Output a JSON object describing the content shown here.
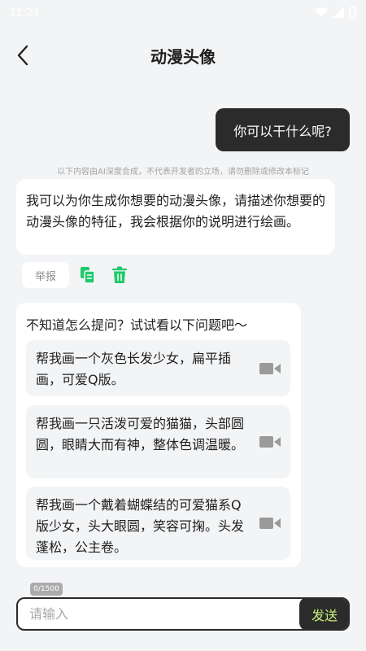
{
  "status_bar": {
    "time": "11:24"
  },
  "header": {
    "title": "动漫头像"
  },
  "chat": {
    "user_message": "你可以干什么呢?",
    "ai_notice": "以下内容由AI深度合成，不代表开发者的立场，请勿删除或修改本标记",
    "ai_reply": "我可以为你生成你想要的动漫头像，请描述你想要的动漫头像的特征，我会根据你的说明进行绘画。",
    "report_label": "举报"
  },
  "suggestions": {
    "title": "不知道怎么提问？试试看以下问题吧～",
    "items": [
      {
        "text": "帮我画一个灰色长发少女，扁平插画，可爱Q版。"
      },
      {
        "text": "帮我画一只活泼可爱的猫猫，头部圆圆，眼睛大而有神，整体色调温暖。"
      },
      {
        "text": "帮我画一个戴着蝴蝶结的可爱猫系Q版少女，头大眼圆，笑容可掬。头发蓬松，公主卷。"
      }
    ]
  },
  "composer": {
    "counter": "0/1500",
    "placeholder": "请输入",
    "send_label": "发送"
  },
  "colors": {
    "accent_green": "#22c96b",
    "dark": "#2b2b2b",
    "send_text": "#c8f07c"
  },
  "icons": [
    "back-arrow-icon",
    "wifi-icon",
    "signal-icon",
    "battery-icon",
    "copy-icon",
    "trash-icon",
    "video-camera-icon"
  ]
}
